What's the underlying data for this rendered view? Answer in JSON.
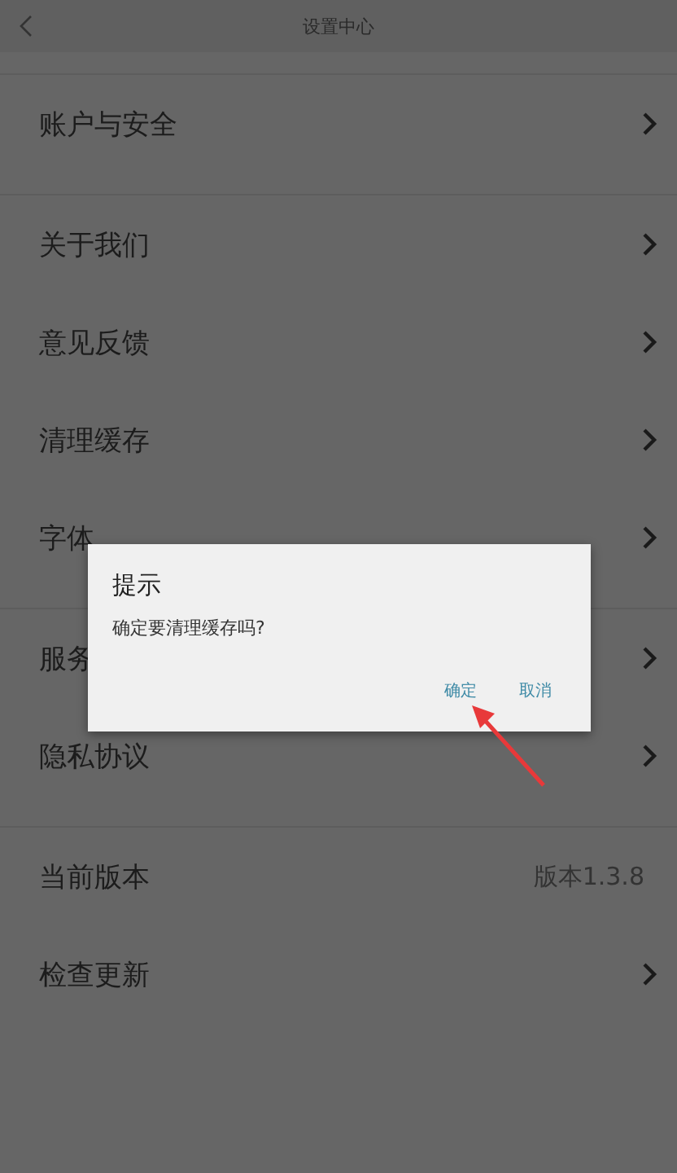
{
  "header": {
    "title": "设置中心"
  },
  "groups": [
    {
      "items": [
        {
          "label": "账户与安全",
          "kind": "link"
        }
      ]
    },
    {
      "items": [
        {
          "label": "关于我们",
          "kind": "link"
        },
        {
          "label": "意见反馈",
          "kind": "link"
        },
        {
          "label": "清理缓存",
          "kind": "link"
        },
        {
          "label": "字体",
          "kind": "link"
        }
      ]
    },
    {
      "items": [
        {
          "label": "服务",
          "kind": "link"
        },
        {
          "label": "隐私协议",
          "kind": "link"
        }
      ]
    },
    {
      "items": [
        {
          "label": "当前版本",
          "kind": "value",
          "value": "版本1.3.8"
        },
        {
          "label": "检查更新",
          "kind": "link"
        }
      ]
    }
  ],
  "dialog": {
    "title": "提示",
    "message": "确定要清理缓存吗?",
    "buttons": [
      {
        "label": "确定"
      },
      {
        "label": "取消"
      }
    ]
  }
}
